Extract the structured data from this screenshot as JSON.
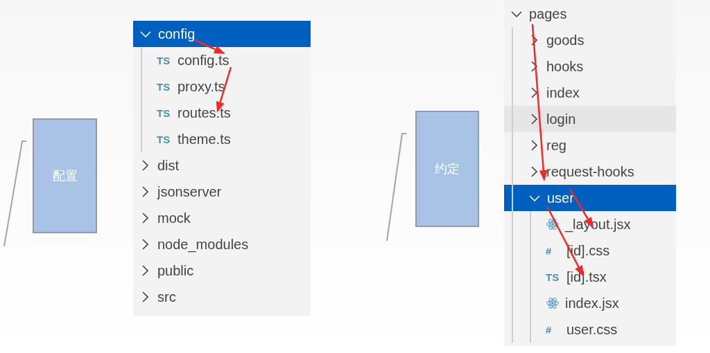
{
  "labels": [
    {
      "text": "配置"
    },
    {
      "text": "约定"
    }
  ],
  "left_tree": [
    {
      "kind": "folder",
      "label": "config",
      "expanded": true,
      "selected": true,
      "hovered": false,
      "children": [
        {
          "kind": "file",
          "badge": "TS",
          "label": "config.ts",
          "selected": false,
          "hovered": false
        },
        {
          "kind": "file",
          "badge": "TS",
          "label": "proxy.ts",
          "selected": false,
          "hovered": false
        },
        {
          "kind": "file",
          "badge": "TS",
          "label": "routes.ts",
          "selected": false,
          "hovered": false
        },
        {
          "kind": "file",
          "badge": "TS",
          "label": "theme.ts",
          "selected": false,
          "hovered": false
        }
      ]
    },
    {
      "kind": "folder",
      "label": "dist",
      "expanded": false,
      "selected": false,
      "hovered": false
    },
    {
      "kind": "folder",
      "label": "jsonserver",
      "expanded": false,
      "selected": false,
      "hovered": false
    },
    {
      "kind": "folder",
      "label": "mock",
      "expanded": false,
      "selected": false,
      "hovered": false
    },
    {
      "kind": "folder",
      "label": "node_modules",
      "expanded": false,
      "selected": false,
      "hovered": false
    },
    {
      "kind": "folder",
      "label": "public",
      "expanded": false,
      "selected": false,
      "hovered": false
    },
    {
      "kind": "folder",
      "label": "src",
      "expanded": false,
      "selected": false,
      "hovered": false
    }
  ],
  "right_tree": [
    {
      "kind": "folder",
      "label": "pages",
      "expanded": true,
      "selected": false,
      "hovered": false,
      "children": [
        {
          "kind": "folder",
          "label": "goods",
          "expanded": false,
          "selected": false,
          "hovered": false
        },
        {
          "kind": "folder",
          "label": "hooks",
          "expanded": false,
          "selected": false,
          "hovered": false
        },
        {
          "kind": "folder",
          "label": "index",
          "expanded": false,
          "selected": false,
          "hovered": false
        },
        {
          "kind": "folder",
          "label": "login",
          "expanded": false,
          "selected": false,
          "hovered": true
        },
        {
          "kind": "folder",
          "label": "reg",
          "expanded": false,
          "selected": false,
          "hovered": false
        },
        {
          "kind": "folder",
          "label": "request-hooks",
          "expanded": false,
          "selected": false,
          "hovered": false
        },
        {
          "kind": "folder",
          "label": "user",
          "expanded": true,
          "selected": true,
          "hovered": false,
          "children": [
            {
              "kind": "react",
              "label": "_layout.jsx",
              "selected": false,
              "hovered": false
            },
            {
              "kind": "file",
              "badge": "#",
              "label": "[id].css",
              "selected": false,
              "hovered": false
            },
            {
              "kind": "file",
              "badge": "TS",
              "label": "[id].tsx",
              "selected": false,
              "hovered": false
            },
            {
              "kind": "react",
              "label": "index.jsx",
              "selected": false,
              "hovered": false
            },
            {
              "kind": "file",
              "badge": "#",
              "label": "user.css",
              "selected": false,
              "hovered": false
            }
          ]
        }
      ]
    }
  ]
}
